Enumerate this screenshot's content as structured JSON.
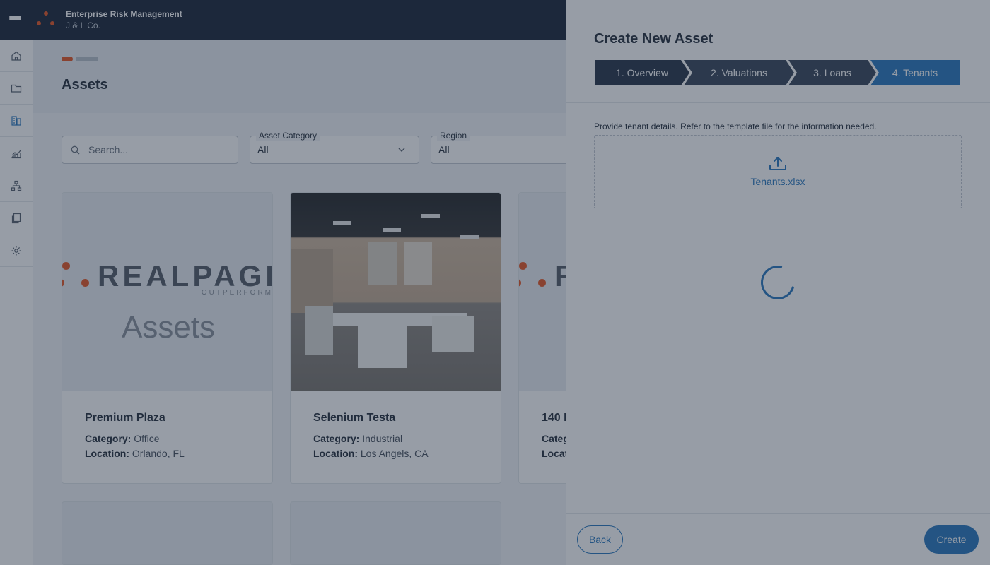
{
  "app": {
    "title": "Enterprise Risk Management",
    "company": "J & L Co."
  },
  "rail": {
    "items": [
      {
        "icon": "home-icon"
      },
      {
        "icon": "folder-icon"
      },
      {
        "icon": "building-icon"
      },
      {
        "icon": "chart-icon"
      },
      {
        "icon": "hierarchy-icon"
      },
      {
        "icon": "copy-icon"
      },
      {
        "icon": "gear-icon"
      }
    ]
  },
  "page": {
    "title": "Assets"
  },
  "filters": {
    "search_placeholder": "Search...",
    "category_label": "Asset Category",
    "category_value": "All",
    "region_label": "Region",
    "region_value": "All"
  },
  "cards": [
    {
      "title": "Premium Plaza",
      "category_label": "Category:",
      "category": "Office",
      "location_label": "Location:",
      "location": "Orlando, FL",
      "placeholder_word": "REALPAGE",
      "placeholder_sub": "OUTPERFORM",
      "placeholder_text": "Assets"
    },
    {
      "title": "Selenium Testa",
      "category_label": "Category:",
      "category": "Industrial",
      "location_label": "Location:",
      "location": "Los Angels, CA"
    },
    {
      "title": "140 I",
      "category_label": "Categ",
      "location_label": "Locat",
      "placeholder_word": "R"
    }
  ],
  "drawer": {
    "title": "Create New Asset",
    "steps": [
      "1. Overview",
      "2. Valuations",
      "3. Loans",
      "4. Tenants"
    ],
    "active_step": 4,
    "instructions": "Provide tenant details. Refer to the template file for the information needed.",
    "file_name": "Tenants.xlsx",
    "back_label": "Back",
    "create_label": "Create"
  },
  "colors": {
    "accent": "#2e7bbf",
    "brand_orange": "#e65a28",
    "topbar": "#1f2a3c"
  }
}
